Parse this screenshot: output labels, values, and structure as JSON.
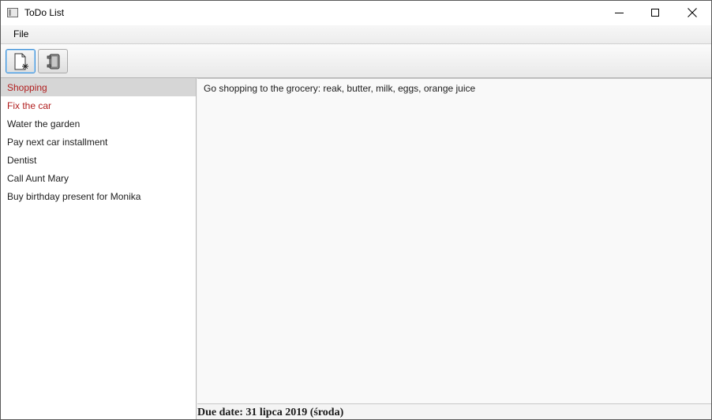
{
  "window": {
    "title": "ToDo List"
  },
  "menu": {
    "items": [
      {
        "label": "File"
      }
    ]
  },
  "toolbar": {
    "buttons": [
      {
        "icon": "new-item-icon",
        "selected": true
      },
      {
        "icon": "details-icon",
        "selected": false
      }
    ]
  },
  "todo_list": {
    "items": [
      {
        "label": "Shopping",
        "selected": true,
        "overdue": true
      },
      {
        "label": "Fix the car",
        "selected": false,
        "overdue": true
      },
      {
        "label": "Water the garden",
        "selected": false,
        "overdue": false
      },
      {
        "label": "Pay next car installment",
        "selected": false,
        "overdue": false
      },
      {
        "label": "Dentist",
        "selected": false,
        "overdue": false
      },
      {
        "label": "Call Aunt Mary",
        "selected": false,
        "overdue": false
      },
      {
        "label": "Buy birthday present for Monika",
        "selected": false,
        "overdue": false
      }
    ]
  },
  "detail": {
    "description": "Go shopping to the grocery: reak, butter, milk, eggs, orange juice",
    "due_date": "Due date: 31 lipca 2019 (środa)"
  },
  "colors": {
    "overdue_text": "#b11e1e",
    "selected_row": "#d6d6d6",
    "toolbar_selected_border": "#3c8fd6"
  }
}
